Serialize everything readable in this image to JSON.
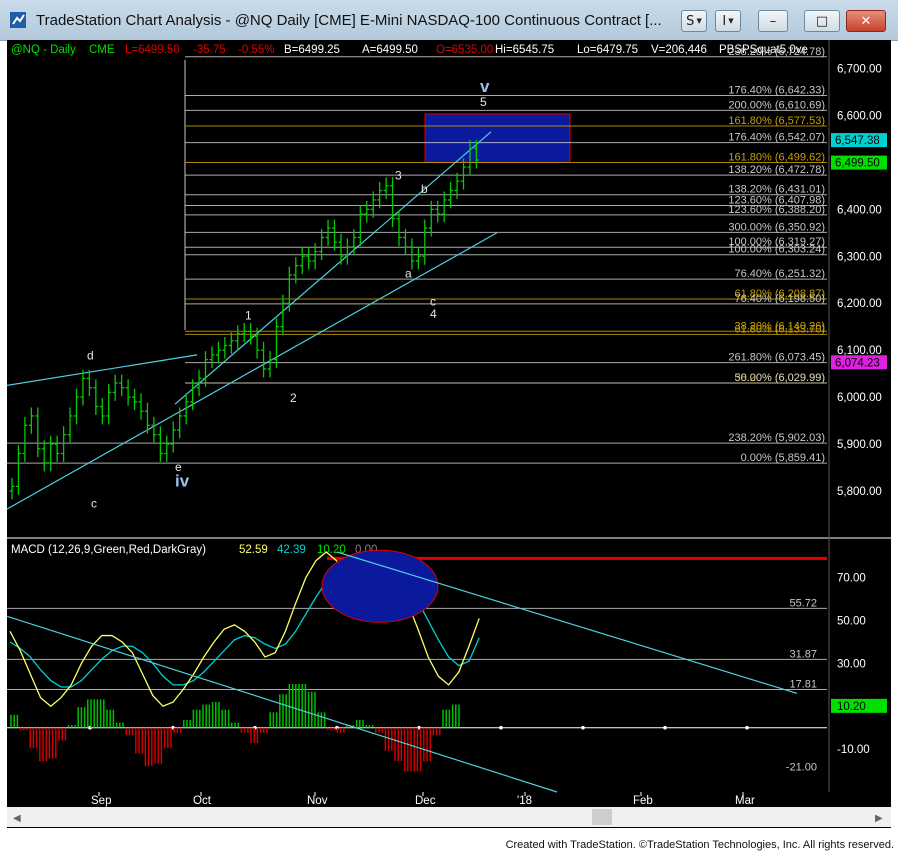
{
  "window": {
    "title": "TradeStation Chart Analysis - @NQ Daily [CME] E-Mini NASDAQ-100 Continuous Contract [...",
    "btn_s": "S",
    "btn_i": "I",
    "btn_min": "–",
    "btn_max": "□",
    "btn_close": "✕"
  },
  "header": {
    "symbol": "@NQ - Daily",
    "exchange": "CME",
    "last": "L=6499.50",
    "change": "-35.75",
    "change_pct": "-0.55%",
    "bid": "B=6499.25",
    "ask": "A=6499.50",
    "open": "O=6535.00",
    "high": "Hi=6545.75",
    "low": "Lo=6479.75",
    "volume": "V=206,446",
    "study": "PBSPSquat5.0ve"
  },
  "colors": {
    "background": "#000000",
    "up_bar": "#00cc00",
    "fib_line": "#c8c8c8",
    "trend_line": "#4fd0e0",
    "target_box": "#0b1a9c",
    "macd_zero": "#ffffff",
    "macd_red_line": "#e00000"
  },
  "chart_data": [
    {
      "type": "ohlc",
      "title": "@NQ Daily",
      "x_labels": [
        "Sep",
        "Oct",
        "Nov",
        "Dec",
        "'18",
        "Feb",
        "Mar"
      ],
      "y_ticks": [
        "5,800.00",
        "5,900.00",
        "6,000.00",
        "6,100.00",
        "6,200.00",
        "6,300.00",
        "6,400.00",
        "6,500.00",
        "6,600.00",
        "6,700.00"
      ],
      "ylim": [
        5700,
        6735
      ],
      "price_tags": [
        {
          "label": "6,547.38",
          "value": 6547.38,
          "color": "#00d0d0"
        },
        {
          "label": "6,499.50",
          "value": 6499.5,
          "color": "#00e000"
        },
        {
          "label": "6,074.23",
          "value": 6074.23,
          "color": "#e020e0"
        }
      ],
      "daily_closes": [
        5810,
        5880,
        5940,
        5960,
        5890,
        5860,
        5900,
        5880,
        5920,
        5960,
        6000,
        6040,
        6020,
        5980,
        5960,
        6010,
        6030,
        6020,
        6000,
        5990,
        5970,
        5940,
        5920,
        5880,
        5900,
        5930,
        5960,
        5990,
        6020,
        6040,
        6080,
        6090,
        6100,
        6110,
        6120,
        6135,
        6140,
        6130,
        6100,
        6060,
        6080,
        6150,
        6200,
        6260,
        6280,
        6300,
        6290,
        6310,
        6340,
        6360,
        6330,
        6300,
        6320,
        6340,
        6390,
        6400,
        6420,
        6440,
        6450,
        6380,
        6340,
        6320,
        6290,
        6300,
        6360,
        6400,
        6390,
        6420,
        6440,
        6460,
        6490,
        6530,
        6505
      ],
      "fib_levels": [
        {
          "label": "238.20% (6,724.78)",
          "value": 6724.78
        },
        {
          "label": "176.40% (6,642.33)",
          "value": 6642.33
        },
        {
          "label": "200.00% (6,610.69)",
          "value": 6610.69
        },
        {
          "label": "161.80% (6,577.53)",
          "value": 6577.53
        },
        {
          "label": "176.40% (6,542.07)",
          "value": 6542.07
        },
        {
          "label": "161.80% (6,499.62)",
          "value": 6499.62
        },
        {
          "label": "138.20% (6,472.78)",
          "value": 6472.78
        },
        {
          "label": "138.20% (6,431.01)",
          "value": 6431.01
        },
        {
          "label": "123.60% (6,407.98)",
          "value": 6407.98
        },
        {
          "label": "123.60% (6,388.20)",
          "value": 6388.2
        },
        {
          "label": "300.00% (6,350.92)",
          "value": 6350.92
        },
        {
          "label": "100.00% (6,319.27)",
          "value": 6319.27
        },
        {
          "label": "100.00% (6,303.24)",
          "value": 6303.24
        },
        {
          "label": "76.40% (6,251.32)",
          "value": 6251.32
        },
        {
          "label": "61.80% (6,208.87)",
          "value": 6208.87
        },
        {
          "label": "76.40% (6,198.50)",
          "value": 6198.5
        },
        {
          "label": "38.20% (6,140.26)",
          "value": 6140.26
        },
        {
          "label": "61.80% (6,133.70)",
          "value": 6133.7
        },
        {
          "label": "261.80% (6,073.45)",
          "value": 6073.45
        },
        {
          "label": "38.20% (6,029.99)",
          "value": 6029.99
        },
        {
          "label": "50.00% (6,029.99)",
          "value": 6029.99
        },
        {
          "label": "238.20% (5,902.03)",
          "value": 5902.03
        },
        {
          "label": "0.00% (5,859.41)",
          "value": 5859.41
        }
      ],
      "target_box": {
        "from": 6499.62,
        "to": 6603
      },
      "wave_labels": [
        {
          "text": "d",
          "value": 6080
        },
        {
          "text": "1",
          "value": 6165
        },
        {
          "text": "2",
          "value": 5990
        },
        {
          "text": "3",
          "value": 6463
        },
        {
          "text": "a",
          "value": 6255
        },
        {
          "text": "b",
          "value": 6435
        },
        {
          "text": "c",
          "value": 6195
        },
        {
          "text": "4",
          "value": 6168
        },
        {
          "text": "5",
          "value": 6620
        },
        {
          "text": "v",
          "value": 6650
        },
        {
          "text": "e",
          "value": 5843
        },
        {
          "text": "iv",
          "value": 5810
        },
        {
          "text": "c",
          "value": 5765
        }
      ]
    },
    {
      "type": "line",
      "title": "MACD (12,26,9,Green,Red,DarkGray)",
      "values_text": [
        "52.59",
        "42.39",
        "10.20",
        "0.00"
      ],
      "y_ticks": [
        "70.00",
        "50.00",
        "30.00",
        "10.00",
        "-10.00"
      ],
      "ylim": [
        -30,
        82
      ],
      "levels": [
        {
          "label": "55.72",
          "value": 55.72
        },
        {
          "label": "31.87",
          "value": 31.87
        },
        {
          "label": "17.81",
          "value": 17.81
        },
        {
          "label": "-21.00",
          "value": -21.0
        }
      ],
      "red_line_value": 79.0,
      "histogram_tag": "10.20",
      "macd": [
        45,
        36,
        25,
        14,
        10,
        14,
        20,
        30,
        38,
        43,
        43,
        40,
        35,
        25,
        15,
        10,
        12,
        18,
        25,
        33,
        40,
        46,
        48,
        45,
        40,
        33,
        35,
        45,
        58,
        70,
        78,
        82,
        78,
        72,
        70,
        73,
        76,
        74,
        70,
        58,
        46,
        33,
        24,
        20,
        26,
        38,
        51
      ],
      "signal": [
        40,
        37,
        33,
        27,
        22,
        19,
        19,
        22,
        27,
        32,
        36,
        38,
        38,
        35,
        30,
        24,
        20,
        20,
        22,
        26,
        31,
        36,
        41,
        43,
        42,
        39,
        37,
        39,
        45,
        53,
        61,
        68,
        72,
        73,
        72,
        72,
        73,
        73,
        72,
        67,
        59,
        50,
        41,
        33,
        29,
        31,
        42
      ]
    }
  ],
  "status": {
    "credit": "Created with TradeStation. ©TradeStation Technologies, Inc. All rights reserved."
  }
}
